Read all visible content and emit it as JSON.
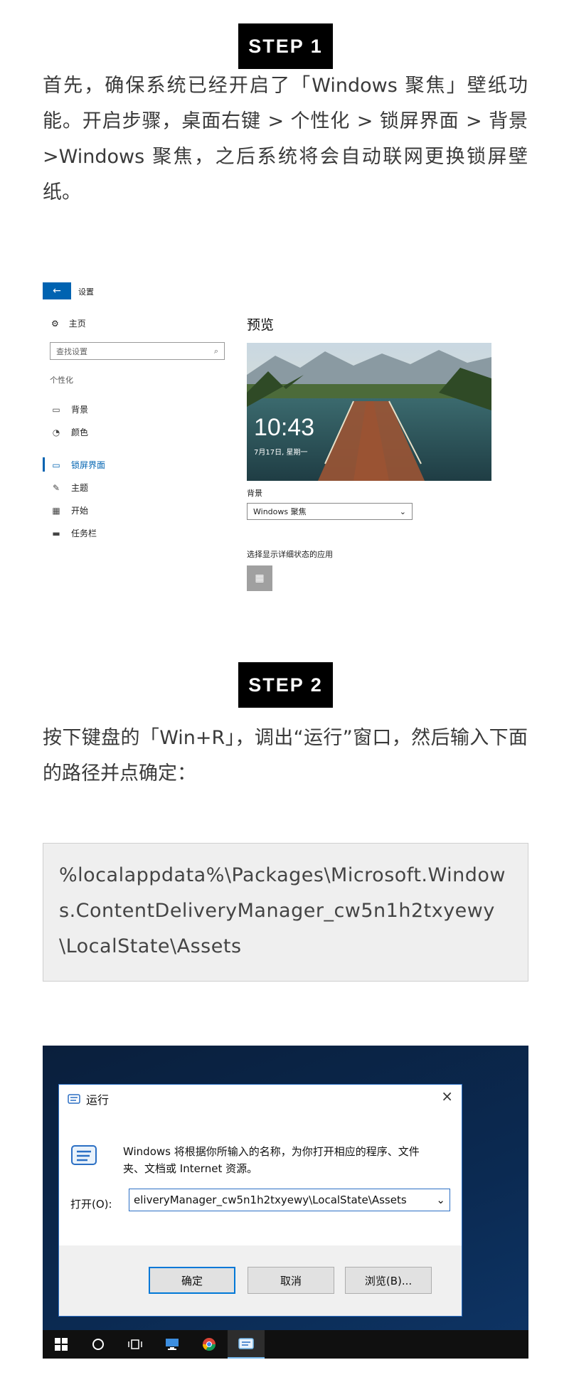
{
  "step1": {
    "badge": "STEP 1",
    "text": "首先，确保系统已经开启了「Windows 聚焦」壁纸功能。开启步骤，桌面右键 > 个性化 > 锁屏界面 > 背景>Windows  聚焦，之后系统将会自动联网更换锁屏壁纸。"
  },
  "settings": {
    "back_icon": "←",
    "app_title": "设置",
    "home_label": "主页",
    "search_placeholder": "查找设置",
    "section_label": "个性化",
    "nav_items": [
      {
        "label": "背景",
        "icon": "image-icon"
      },
      {
        "label": "颜色",
        "icon": "palette-icon"
      },
      {
        "label": "锁屏界面",
        "icon": "lock-screen-icon"
      },
      {
        "label": "主题",
        "icon": "theme-icon"
      },
      {
        "label": "开始",
        "icon": "start-icon"
      },
      {
        "label": "任务栏",
        "icon": "taskbar-icon"
      }
    ],
    "preview_title": "预览",
    "lock_time": "10:43",
    "lock_date": "7月17日, 星期一",
    "background_label": "背景",
    "background_value": "Windows 聚焦",
    "status_apps_label": "选择显示详细状态的应用"
  },
  "step2": {
    "badge": "STEP 2",
    "text": "按下键盘的「Win+R」，调出“运行”窗口，然后输入下面的路径并点确定："
  },
  "path_text": "%localappdata%\\Packages\\Microsoft.Windows.ContentDeliveryManager_cw5n1h2txyewy\\LocalState\\Assets",
  "run_dialog": {
    "title": "运行",
    "close": "×",
    "description": "Windows 将根据你所输入的名称，为你打开相应的程序、文件夹、文档或 Internet 资源。",
    "open_label": "打开(O):",
    "open_value": "eliveryManager_cw5n1h2txyewy\\LocalState\\Assets",
    "ok_label": "确定",
    "cancel_label": "取消",
    "browse_label": "浏览(B)..."
  },
  "colors": {
    "accent": "#0063b1",
    "badge_bg": "#000000",
    "path_bg": "#efefef"
  }
}
